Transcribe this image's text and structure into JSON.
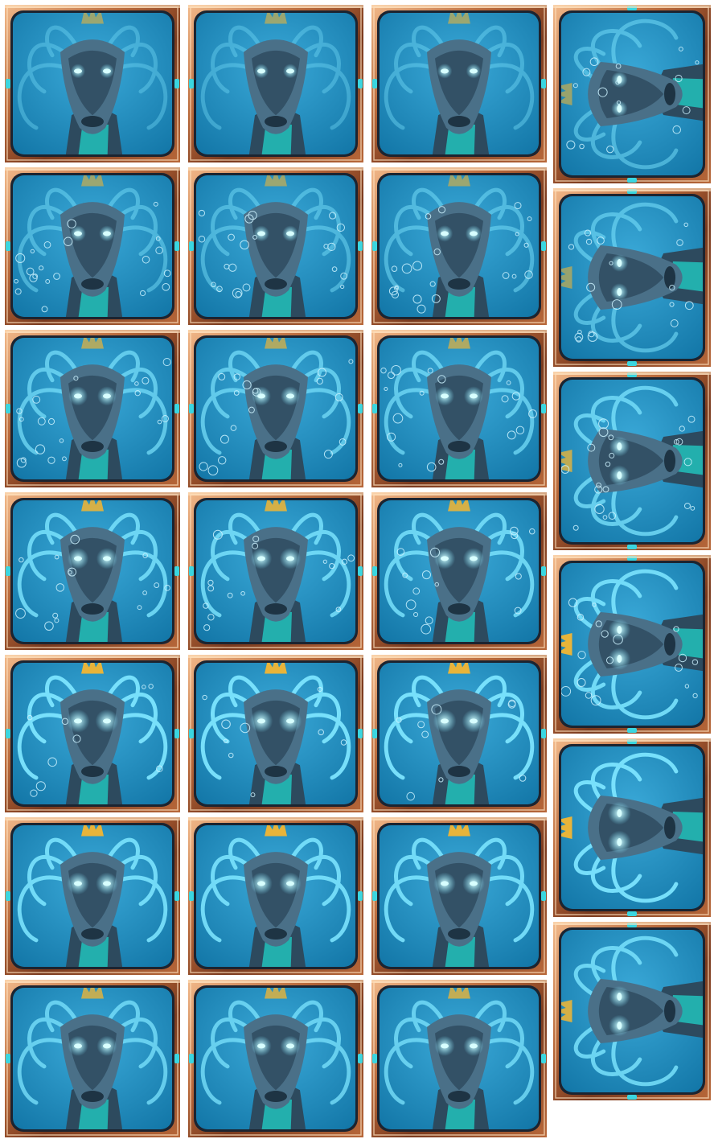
{
  "sprite_sheet": {
    "subject": "water-dragon-symbol",
    "frame_colors": {
      "frame_dark": "#7a3a1e",
      "frame_mid": "#b8683a",
      "frame_light": "#f2b98a",
      "frame_glow": "#ffe3c0",
      "inner_rim": "#1c2430",
      "gem": "#3ad6e0",
      "water_light": "#3aa9d8",
      "water_deep": "#0d6fa0",
      "dragon_dark": "#2d4a5e",
      "dragon_mid": "#4a7088",
      "eye_glow": "#d8ffff",
      "neck_teal": "#20c8c0",
      "crown_gold": "#e8b43a",
      "horn_glow": "#7ee6ff",
      "bubble": "#cdf3ff"
    },
    "portrait_frames": [
      {
        "row": 1,
        "col": 1,
        "bubbles": 0,
        "glow": 0.0,
        "crown": 0.6
      },
      {
        "row": 1,
        "col": 2,
        "bubbles": 0,
        "glow": 0.0,
        "crown": 0.6
      },
      {
        "row": 1,
        "col": 3,
        "bubbles": 0,
        "glow": 0.05,
        "crown": 0.6
      },
      {
        "row": 2,
        "col": 1,
        "bubbles": 14,
        "glow": 0.15,
        "crown": 0.6
      },
      {
        "row": 2,
        "col": 2,
        "bubbles": 14,
        "glow": 0.15,
        "crown": 0.6
      },
      {
        "row": 2,
        "col": 3,
        "bubbles": 14,
        "glow": 0.2,
        "crown": 0.6
      },
      {
        "row": 3,
        "col": 1,
        "bubbles": 12,
        "glow": 0.5,
        "crown": 0.7
      },
      {
        "row": 3,
        "col": 2,
        "bubbles": 12,
        "glow": 0.5,
        "crown": 0.7
      },
      {
        "row": 3,
        "col": 3,
        "bubbles": 12,
        "glow": 0.5,
        "crown": 0.7
      },
      {
        "row": 4,
        "col": 1,
        "bubbles": 10,
        "glow": 0.7,
        "crown": 0.9
      },
      {
        "row": 4,
        "col": 2,
        "bubbles": 10,
        "glow": 0.7,
        "crown": 0.9
      },
      {
        "row": 4,
        "col": 3,
        "bubbles": 10,
        "glow": 0.7,
        "crown": 0.9
      },
      {
        "row": 5,
        "col": 1,
        "bubbles": 6,
        "glow": 0.9,
        "crown": 1.0
      },
      {
        "row": 5,
        "col": 2,
        "bubbles": 6,
        "glow": 0.9,
        "crown": 1.0
      },
      {
        "row": 5,
        "col": 3,
        "bubbles": 6,
        "glow": 0.9,
        "crown": 1.0
      },
      {
        "row": 6,
        "col": 1,
        "bubbles": 0,
        "glow": 0.8,
        "crown": 1.0
      },
      {
        "row": 6,
        "col": 2,
        "bubbles": 0,
        "glow": 0.8,
        "crown": 1.0
      },
      {
        "row": 6,
        "col": 3,
        "bubbles": 0,
        "glow": 0.8,
        "crown": 1.0
      },
      {
        "row": 7,
        "col": 1,
        "bubbles": 0,
        "glow": 0.6,
        "crown": 0.8
      },
      {
        "row": 7,
        "col": 2,
        "bubbles": 0,
        "glow": 0.6,
        "crown": 0.8
      },
      {
        "row": 7,
        "col": 3,
        "bubbles": 0,
        "glow": 0.6,
        "crown": 0.8
      }
    ],
    "sideways_frames": [
      {
        "index": 1,
        "bubbles": 10,
        "glow": 0.2,
        "crown": 0.6
      },
      {
        "index": 2,
        "bubbles": 12,
        "glow": 0.3,
        "crown": 0.6
      },
      {
        "index": 3,
        "bubbles": 14,
        "glow": 0.6,
        "crown": 0.8
      },
      {
        "index": 4,
        "bubbles": 12,
        "glow": 0.8,
        "crown": 1.0
      },
      {
        "index": 5,
        "bubbles": 0,
        "glow": 0.9,
        "crown": 1.0
      },
      {
        "index": 6,
        "bubbles": 0,
        "glow": 0.7,
        "crown": 0.9
      }
    ]
  }
}
